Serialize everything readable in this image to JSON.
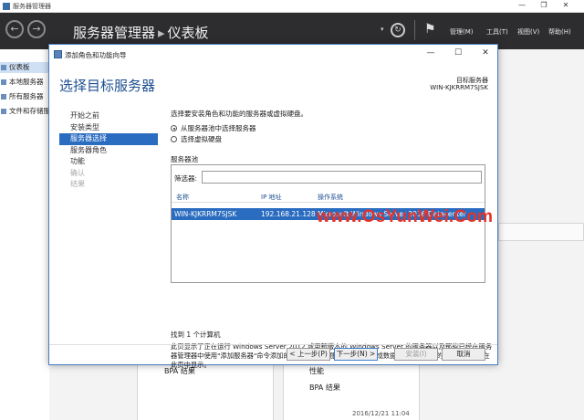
{
  "window": {
    "title": "服务器管理器",
    "controls": {
      "minimize": "—",
      "restore": "❐",
      "close": "✕"
    }
  },
  "header": {
    "back_icon": "←",
    "forward_icon": "→",
    "breadcrumb_root": "服务器管理器",
    "breadcrumb_sep": "▸",
    "breadcrumb_page": "仪表板",
    "dropdown_icon": "▾",
    "refresh_icon": "↻",
    "flag_icon": "⚑",
    "menus": [
      "管理(M)",
      "工具(T)",
      "视图(V)",
      "帮助(H)"
    ]
  },
  "sidebar": {
    "items": [
      {
        "label": "仪表板",
        "active": true
      },
      {
        "label": "本地服务器"
      },
      {
        "label": "所有服务器"
      },
      {
        "label": "文件和存储服务"
      }
    ]
  },
  "background": {
    "tile_left_bpa": "BPA 结果",
    "tile_right_perf": "性能",
    "tile_right_bpa": "BPA 结果",
    "timestamp": "2016/12/21 11:04"
  },
  "dialog": {
    "title": "添加角色和功能向导",
    "controls": {
      "minimize": "—",
      "maximize": "☐",
      "close": "✕"
    },
    "heading": "选择目标服务器",
    "target_label": "目标服务器",
    "target_value": "WIN-KJKRRM7SJSK",
    "steps": [
      {
        "label": "开始之前",
        "state": "normal"
      },
      {
        "label": "安装类型",
        "state": "normal"
      },
      {
        "label": "服务器选择",
        "state": "active"
      },
      {
        "label": "服务器角色",
        "state": "normal"
      },
      {
        "label": "功能",
        "state": "normal"
      },
      {
        "label": "确认",
        "state": "disabled"
      },
      {
        "label": "结果",
        "state": "disabled"
      }
    ],
    "instruction": "选择要安装角色和功能的服务器或虚拟硬盘。",
    "options": [
      {
        "label": "从服务器池中选择服务器",
        "selected": true
      },
      {
        "label": "选择虚拟硬盘",
        "selected": false
      }
    ],
    "pool_label": "服务器池",
    "filter_label": "筛选器:",
    "filter_value": "",
    "columns": [
      "名称",
      "IP 地址",
      "操作系统"
    ],
    "rows": [
      {
        "name": "WIN-KJKRRM7SJSK",
        "ip": "192.168.21.128",
        "os": "Microsoft Windows Server 2016 Datacenter"
      }
    ],
    "found": "找到 1 个计算机",
    "description": "此页显示了正在运行 Windows Server 2012 或更新版本的 Windows Server 的服务器以及那些已经在服务器管理器中使用\"添加服务器\"命令添加的服务器。脱机服务器和尚未完成数据收集的新添加的服务器将不会在此页中显示。",
    "buttons": {
      "prev": "< 上一步(P)",
      "next": "下一步(N) >",
      "install": "安装(I)",
      "cancel": "取消"
    }
  },
  "watermark": "www.OsYunWei.Com",
  "colors": {
    "accent": "#2a6cc0",
    "header_bg": "#2d2d30",
    "heading": "#1d4f91",
    "watermark": "#e4332a"
  }
}
